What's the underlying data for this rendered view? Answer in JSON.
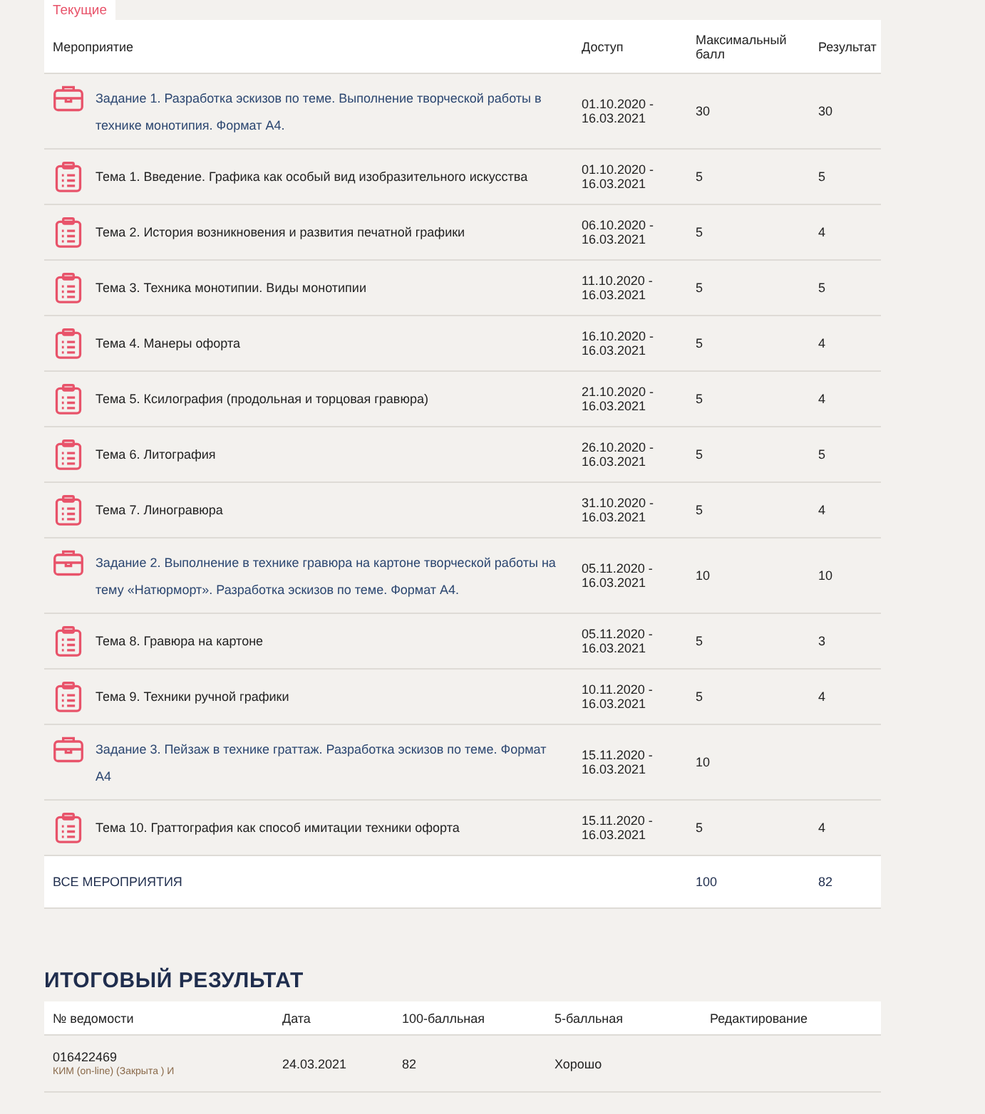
{
  "tabs": [
    {
      "label": "Текущие",
      "selected": true
    }
  ],
  "table": {
    "columns": [
      "Мероприятие",
      "Доступ",
      "Максимальный балл",
      "Результат"
    ],
    "rows": [
      {
        "kind": "task",
        "title": "Задание 1. Разработка эскизов по теме. Выполнение творческой работы в технике монотипия. Формат А4.",
        "access": "01.10.2020 - 16.03.2021",
        "max": "30",
        "result": "30"
      },
      {
        "kind": "topic",
        "title": "Тема 1. Введение. Графика как особый вид изобразительного искусства",
        "access": "01.10.2020 - 16.03.2021",
        "max": "5",
        "result": "5"
      },
      {
        "kind": "topic",
        "title": "Тема 2. История возникновения и развития печатной графики",
        "access": "06.10.2020 - 16.03.2021",
        "max": "5",
        "result": "4"
      },
      {
        "kind": "topic",
        "title": "Тема 3. Техника монотипии. Виды монотипии",
        "access": "11.10.2020 - 16.03.2021",
        "max": "5",
        "result": "5"
      },
      {
        "kind": "topic",
        "title": "Тема 4. Манеры офорта",
        "access": "16.10.2020 - 16.03.2021",
        "max": "5",
        "result": "4"
      },
      {
        "kind": "topic",
        "title": "Тема 5. Ксилография (продольная и торцовая гравюра)",
        "access": "21.10.2020 - 16.03.2021",
        "max": "5",
        "result": "4"
      },
      {
        "kind": "topic",
        "title": "Тема 6. Литография",
        "access": "26.10.2020 - 16.03.2021",
        "max": "5",
        "result": "5"
      },
      {
        "kind": "topic",
        "title": "Тема 7. Линогравюра",
        "access": "31.10.2020 - 16.03.2021",
        "max": "5",
        "result": "4"
      },
      {
        "kind": "task",
        "title": "Задание 2. Выполнение в технике гравюра на картоне творческой работы на тему «Натюрморт». Разработка эскизов по теме. Формат А4.",
        "access": "05.11.2020 - 16.03.2021",
        "max": "10",
        "result": "10"
      },
      {
        "kind": "topic",
        "title": "Тема 8. Гравюра на картоне",
        "access": "05.11.2020 - 16.03.2021",
        "max": "5",
        "result": "3"
      },
      {
        "kind": "topic",
        "title": "Тема 9. Техники ручной графики",
        "access": "10.11.2020 - 16.03.2021",
        "max": "5",
        "result": "4"
      },
      {
        "kind": "task",
        "title": "Задание 3. Пейзаж в технике граттаж. Разработка эскизов по теме. Формат А4",
        "access": "15.11.2020 - 16.03.2021",
        "max": "10"
      },
      {
        "kind": "topic",
        "title": "Тема 10. Граттография как способ имитации техники офорта",
        "access": "15.11.2020 - 16.03.2021",
        "max": "5",
        "result": "4"
      }
    ],
    "total": {
      "label": "ВСЕ МЕРОПРИЯТИЯ",
      "max": "100",
      "result": "82"
    }
  },
  "final": {
    "title": "ИТОГОВЫЙ РЕЗУЛЬТАТ",
    "columns": [
      "№ ведомости",
      "Дата",
      "100-балльная",
      "5-балльная",
      "Редактирование"
    ],
    "rows": [
      {
        "number": "016422469",
        "note": "КИМ (on-line) (Закрыта ) И",
        "date": "24.03.2021",
        "score100": "82",
        "score5": "Хорошо"
      }
    ]
  }
}
